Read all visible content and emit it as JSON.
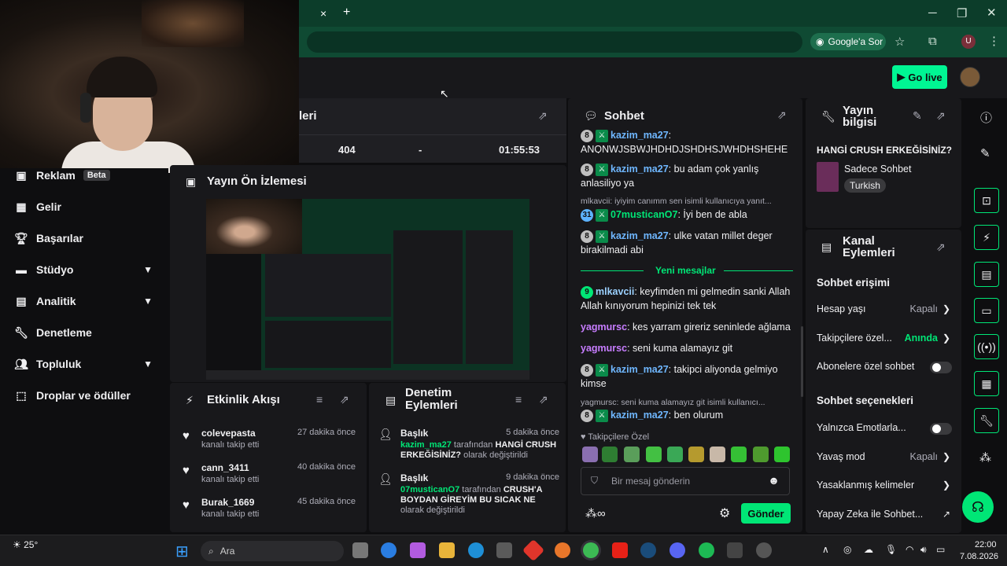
{
  "browser": {
    "ask_google": "Google'a Sor",
    "new_tab": "+",
    "close_tab": "×",
    "profile_initial": "U"
  },
  "topbar": {
    "go_live": "Go live"
  },
  "sidebar": {
    "items": [
      {
        "label": "Reklam",
        "badge": "Beta",
        "icon": "ad-icon"
      },
      {
        "label": "Gelir",
        "icon": "revenue-icon"
      },
      {
        "label": "Başarılar",
        "icon": "trophy-icon"
      },
      {
        "label": "Stüdyo",
        "icon": "studio-icon",
        "expandable": true
      },
      {
        "label": "Analitik",
        "icon": "analytics-icon",
        "expandable": true
      },
      {
        "label": "Denetleme",
        "icon": "wrench-icon"
      },
      {
        "label": "Topluluk",
        "icon": "community-icon",
        "expandable": true
      },
      {
        "label": "Droplar ve ödüller",
        "icon": "drops-icon"
      }
    ]
  },
  "stats": {
    "title_fragment": "leri",
    "values": [
      "404",
      "-",
      "01:55:53"
    ]
  },
  "preview": {
    "title": "Yayın Ön İzlemesi"
  },
  "activity": {
    "title": "Etkinlik Akışı",
    "items": [
      {
        "name": "colevepasta",
        "action": "kanalı takip etti",
        "time": "27 dakika önce"
      },
      {
        "name": "cann_3411",
        "action": "kanalı takip etti",
        "time": "40 dakika önce"
      },
      {
        "name": "Burak_1669",
        "action": "kanalı takip etti",
        "time": "45 dakika önce"
      }
    ]
  },
  "mod_actions": {
    "title": "Denetim Eylemleri",
    "items": [
      {
        "type": "Başlık",
        "time": "5 dakika önce",
        "user": "kazim_ma27",
        "by": " tarafından ",
        "value": "HANGİ CRUSH ERKEĞİSİNİZ?",
        "suffix": " olarak değiştirildi"
      },
      {
        "type": "Başlık",
        "time": "9 dakika önce",
        "user": "07musticanO7",
        "by": " tarafından ",
        "value": "CRUSH'A BOYDAN GİREYİM BU SICAK NE",
        "suffix": " olarak değiştirildi"
      }
    ]
  },
  "chat": {
    "title": "Sohbet",
    "messages": [
      {
        "badge": "8",
        "user": "kazim_ma27",
        "text": "ANQNWJSBWJHDHDJSHDHSJWHDHSHEHE",
        "partial": true
      },
      {
        "badge": "8",
        "user": "kazim_ma27",
        "text": "bu adam çok yanlış anlasiliyo ya"
      },
      {
        "reply": "mlkavcii: iyiyim canımm sen isimli kullanıcıya yanıt...",
        "badge": "31",
        "user": "07musticanO7",
        "text": "İyi ben de abla"
      },
      {
        "badge": "8",
        "user": "kazim_ma27",
        "text": "ulke vatan millet deger birakilmadi abi"
      },
      {
        "badge": "9",
        "user": "mlkavcii",
        "text": "keyfimden mi gelmedin sanki Allah Allah kınıyorum hepinizi tek tek"
      },
      {
        "user": "yagmursc",
        "text": "kes yarram gireriz seninlede ağlama"
      },
      {
        "user": "yagmursc",
        "text": "seni kuma alamayız git"
      },
      {
        "badge": "8",
        "user": "kazim_ma27",
        "text": "takipci aliyonda gelmiyo kimse"
      },
      {
        "reply": "yagmursc: seni kuma alamayız git isimli kullanıcı...",
        "badge": "8",
        "user": "kazim_ma27",
        "text": "ben olurum"
      }
    ],
    "new_messages": "Yeni mesajlar",
    "followers_only": "Takipçilere Özel",
    "input_placeholder": "Bir mesaj gönderin",
    "send": "Gönder"
  },
  "stream_info": {
    "title": "Yayın bilgisi",
    "stream_title": "HANGİ CRUSH ERKEĞİSİNİZ?",
    "category": "Sadece Sohbet",
    "tag": "Turkish"
  },
  "channel_actions": {
    "title": "Kanal Eylemleri",
    "chat_access": "Sohbet erişimi",
    "account_age": {
      "label": "Hesap yaşı",
      "value": "Kapalı"
    },
    "followers_only": {
      "label": "Takipçilere özel...",
      "value": "Anında"
    },
    "subs_only": {
      "label": "Abonelere özel sohbet"
    },
    "chat_options": "Sohbet seçenekleri",
    "emotes_only": {
      "label": "Yalnızca Emotlarla..."
    },
    "slow_mode": {
      "label": "Yavaş mod",
      "value": "Kapalı"
    },
    "banned_words": {
      "label": "Yasaklanmış kelimeler"
    },
    "ai_chat": {
      "label": "Yapay Zeka ile Sohbet..."
    }
  },
  "taskbar": {
    "weather": "25°",
    "search": "Ara",
    "time": "22:00",
    "date": "7.08.2026"
  },
  "colors": {
    "accent": "#00e676",
    "panel": "#18181b",
    "bg": "#0e0e10",
    "chrome": "#0c3d2a"
  }
}
